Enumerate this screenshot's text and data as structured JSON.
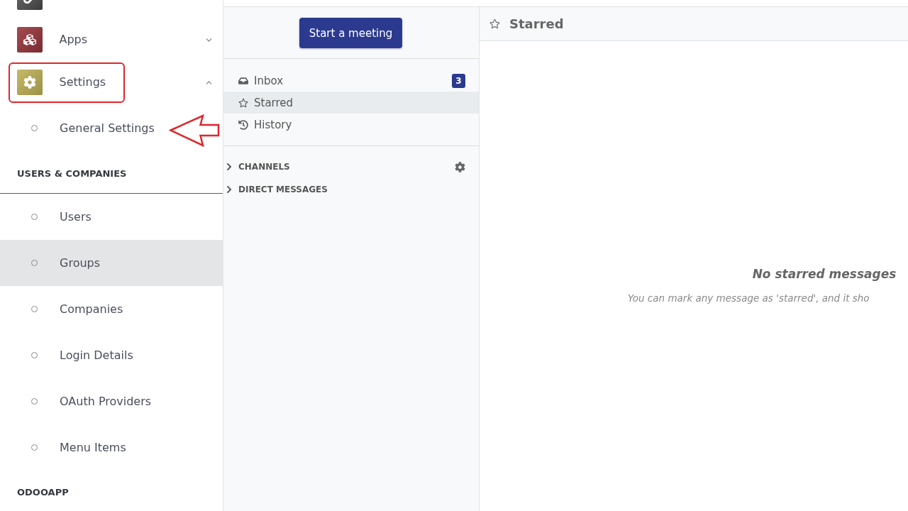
{
  "drawer": {
    "apps": [
      {
        "outlined": false
      },
      {
        "label": "Apps",
        "expanded": false,
        "outlined": false
      },
      {
        "label": "Settings",
        "expanded": true,
        "outlined": true,
        "children": [
          {
            "label": "General Settings",
            "pointed_at": true
          }
        ]
      }
    ],
    "sections": [
      {
        "heading": "USERS & COMPANIES",
        "items": [
          {
            "label": "Users",
            "selected": false
          },
          {
            "label": "Groups",
            "selected": true
          },
          {
            "label": "Companies",
            "selected": false
          },
          {
            "label": "Login Details",
            "selected": false
          },
          {
            "label": "OAuth Providers",
            "selected": false
          },
          {
            "label": "Menu Items",
            "selected": false
          }
        ]
      },
      {
        "heading": "ODOOAPP"
      }
    ]
  },
  "discuss": {
    "start_button": "Start a meeting",
    "mailboxes": [
      {
        "label": "Inbox",
        "counter": "3",
        "selected": false
      },
      {
        "label": "Starred",
        "selected": true
      },
      {
        "label": "History",
        "selected": false
      }
    ],
    "categories": [
      {
        "label": "CHANNELS",
        "expanded": false,
        "settings": true
      },
      {
        "label": "DIRECT MESSAGES",
        "expanded": false,
        "settings": false
      }
    ]
  },
  "thread": {
    "title": "Starred",
    "empty_title": "No starred messages",
    "empty_text": "You can mark any message as 'starred', and it sho"
  }
}
